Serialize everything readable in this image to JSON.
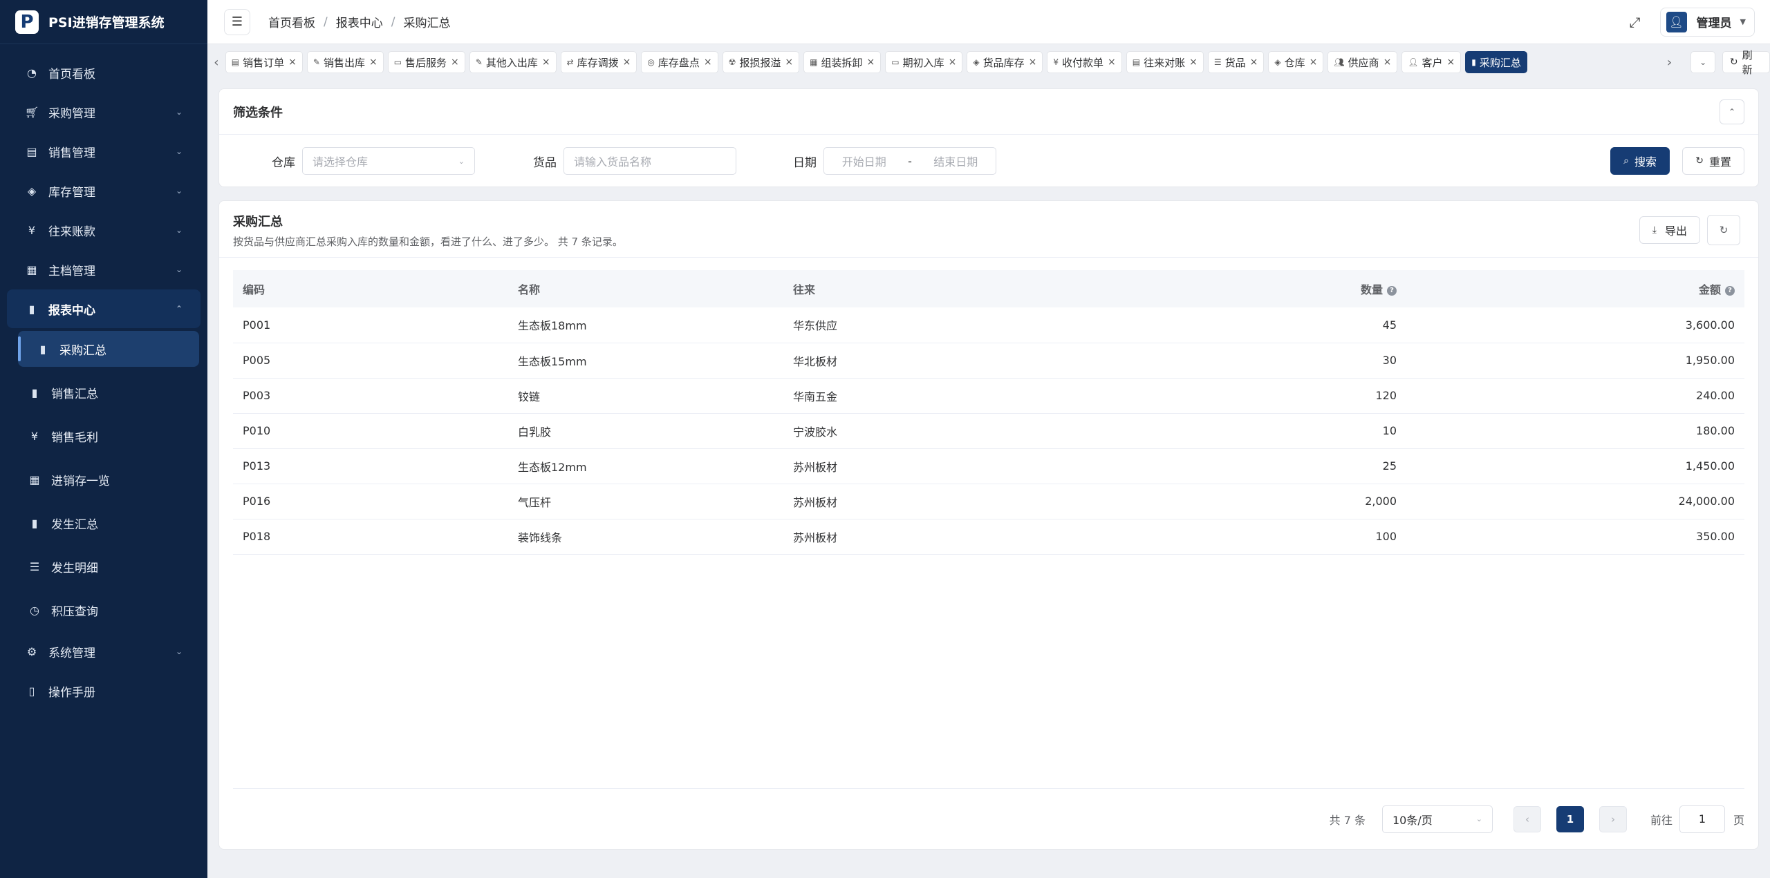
{
  "app": {
    "logo_letter": "P",
    "title": "PSI进销存管理系统"
  },
  "sidebar": {
    "items": [
      {
        "label": "首页看板",
        "icon": "dashboard-icon"
      },
      {
        "label": "采购管理",
        "icon": "cart-icon"
      },
      {
        "label": "销售管理",
        "icon": "sales-icon"
      },
      {
        "label": "库存管理",
        "icon": "layers-icon"
      },
      {
        "label": "往来账款",
        "icon": "yen-icon"
      },
      {
        "label": "主档管理",
        "icon": "archive-icon"
      },
      {
        "label": "报表中心",
        "icon": "bar-chart-icon"
      },
      {
        "label": "系统管理",
        "icon": "gear-icon"
      },
      {
        "label": "操作手册",
        "icon": "book-icon"
      }
    ],
    "report_sub": [
      {
        "label": "采购汇总",
        "icon": "bar-chart-icon"
      },
      {
        "label": "销售汇总",
        "icon": "bar-chart-icon"
      },
      {
        "label": "销售毛利",
        "icon": "yen-icon"
      },
      {
        "label": "进销存一览",
        "icon": "table-icon"
      },
      {
        "label": "发生汇总",
        "icon": "bar-chart-icon"
      },
      {
        "label": "发生明细",
        "icon": "list-icon"
      },
      {
        "label": "积压查询",
        "icon": "clock-icon"
      }
    ]
  },
  "header": {
    "breadcrumb": [
      "首页看板",
      "报表中心",
      "采购汇总"
    ],
    "user": "管理员"
  },
  "tabs": {
    "items": [
      {
        "label": "销售订单"
      },
      {
        "label": "销售出库"
      },
      {
        "label": "售后服务"
      },
      {
        "label": "其他入出库"
      },
      {
        "label": "库存调拨"
      },
      {
        "label": "库存盘点"
      },
      {
        "label": "报损报溢"
      },
      {
        "label": "组装拆卸"
      },
      {
        "label": "期初入库"
      },
      {
        "label": "货品库存"
      },
      {
        "label": "收付款单"
      },
      {
        "label": "往来对账"
      },
      {
        "label": "货品"
      },
      {
        "label": "仓库"
      },
      {
        "label": "供应商"
      },
      {
        "label": "客户"
      },
      {
        "label": "采购汇总"
      }
    ],
    "refresh_label": "刷新"
  },
  "filter": {
    "title": "筛选条件",
    "warehouse_label": "仓库",
    "warehouse_placeholder": "请选择仓库",
    "goods_label": "货品",
    "goods_placeholder": "请输入货品名称",
    "date_label": "日期",
    "date_start": "开始日期",
    "date_sep": "-",
    "date_end": "结束日期",
    "search_label": "搜索",
    "reset_label": "重置"
  },
  "report": {
    "title": "采购汇总",
    "desc": "按货品与供应商汇总采购入库的数量和金额，看进了什么、进了多少。 共 7 条记录。",
    "export_label": "导出",
    "columns": [
      "编码",
      "名称",
      "往来",
      "数量",
      "金额"
    ],
    "rows": [
      [
        "P001",
        "生态板18mm",
        "华东供应",
        "45",
        "3,600.00"
      ],
      [
        "P005",
        "生态板15mm",
        "华北板材",
        "30",
        "1,950.00"
      ],
      [
        "P003",
        "铰链",
        "华南五金",
        "120",
        "240.00"
      ],
      [
        "P010",
        "白乳胶",
        "宁波胶水",
        "10",
        "180.00"
      ],
      [
        "P013",
        "生态板12mm",
        "苏州板材",
        "25",
        "1,450.00"
      ],
      [
        "P016",
        "气压杆",
        "苏州板材",
        "2,000",
        "24,000.00"
      ],
      [
        "P018",
        "装饰线条",
        "苏州板材",
        "100",
        "350.00"
      ]
    ]
  },
  "pager": {
    "total": "共 7 条",
    "page_size": "10条/页",
    "current": "1",
    "goto_label": "前往",
    "goto_value": "1",
    "page_suffix": "页"
  },
  "colors": {
    "primary": "#163c74",
    "sidebar_bg": "#0f2444"
  }
}
